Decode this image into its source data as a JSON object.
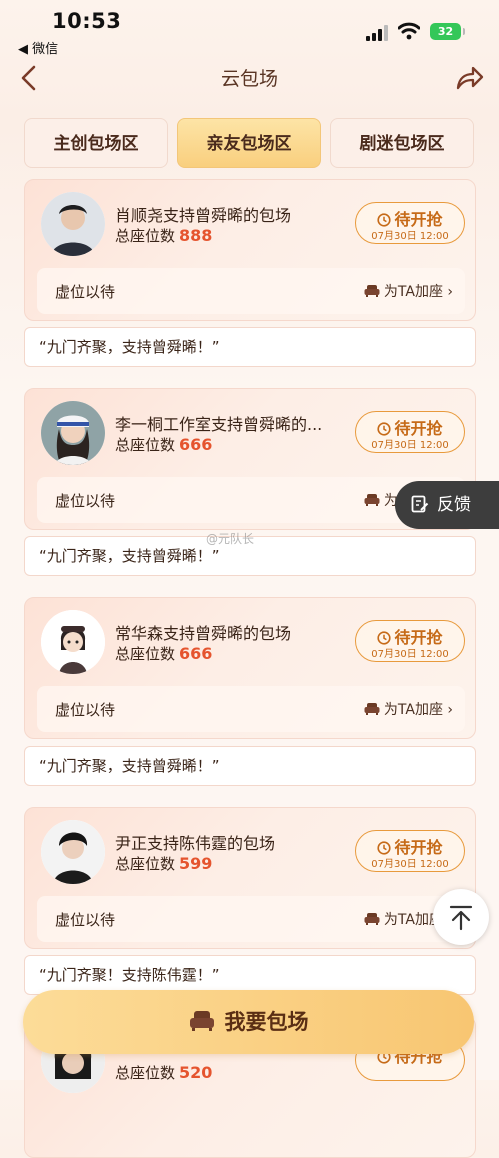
{
  "status_bar": {
    "time": "10:53",
    "back_app": "◀ 微信",
    "battery": "32"
  },
  "nav": {
    "title": "云包场"
  },
  "tabs": [
    {
      "label": "主创包场区",
      "active": false
    },
    {
      "label": "亲友包场区",
      "active": true
    },
    {
      "label": "剧迷包场区",
      "active": false
    }
  ],
  "cards": [
    {
      "title": "肖顺尧支持曾舜晞的包场",
      "seats_label": "总座位数",
      "seats": "888",
      "status": "待开抢",
      "status_time": "07月30日 12:00",
      "waiting": "虚位以待",
      "add_seat": "为TA加座 ›",
      "quote": "“九门齐聚，支持曾舜晞！”"
    },
    {
      "title": "李一桐工作室支持曾舜晞的...",
      "seats_label": "总座位数",
      "seats": "666",
      "status": "待开抢",
      "status_time": "07月30日 12:00",
      "waiting": "虚位以待",
      "add_seat": "为TA加座 ›",
      "quote": "“九门齐聚，支持曾舜晞！”"
    },
    {
      "title": "常华森支持曾舜晞的包场",
      "seats_label": "总座位数",
      "seats": "666",
      "status": "待开抢",
      "status_time": "07月30日 12:00",
      "waiting": "虚位以待",
      "add_seat": "为TA加座 ›",
      "quote": "“九门齐聚，支持曾舜晞！”"
    },
    {
      "title": "尹正支持陈伟霆的包场",
      "seats_label": "总座位数",
      "seats": "599",
      "status": "待开抢",
      "status_time": "07月30日 12:00",
      "waiting": "虚位以待",
      "add_seat": "为TA加座 ›",
      "quote": "“九门齐聚！支持陈伟霆！”"
    },
    {
      "title": "",
      "seats_label": "总座位数",
      "seats": "520",
      "status": "待开抢",
      "status_time": "",
      "waiting": "",
      "add_seat": "",
      "quote": ""
    }
  ],
  "feedback": "反馈",
  "watermark": "@元队长",
  "cta": "我要包场"
}
